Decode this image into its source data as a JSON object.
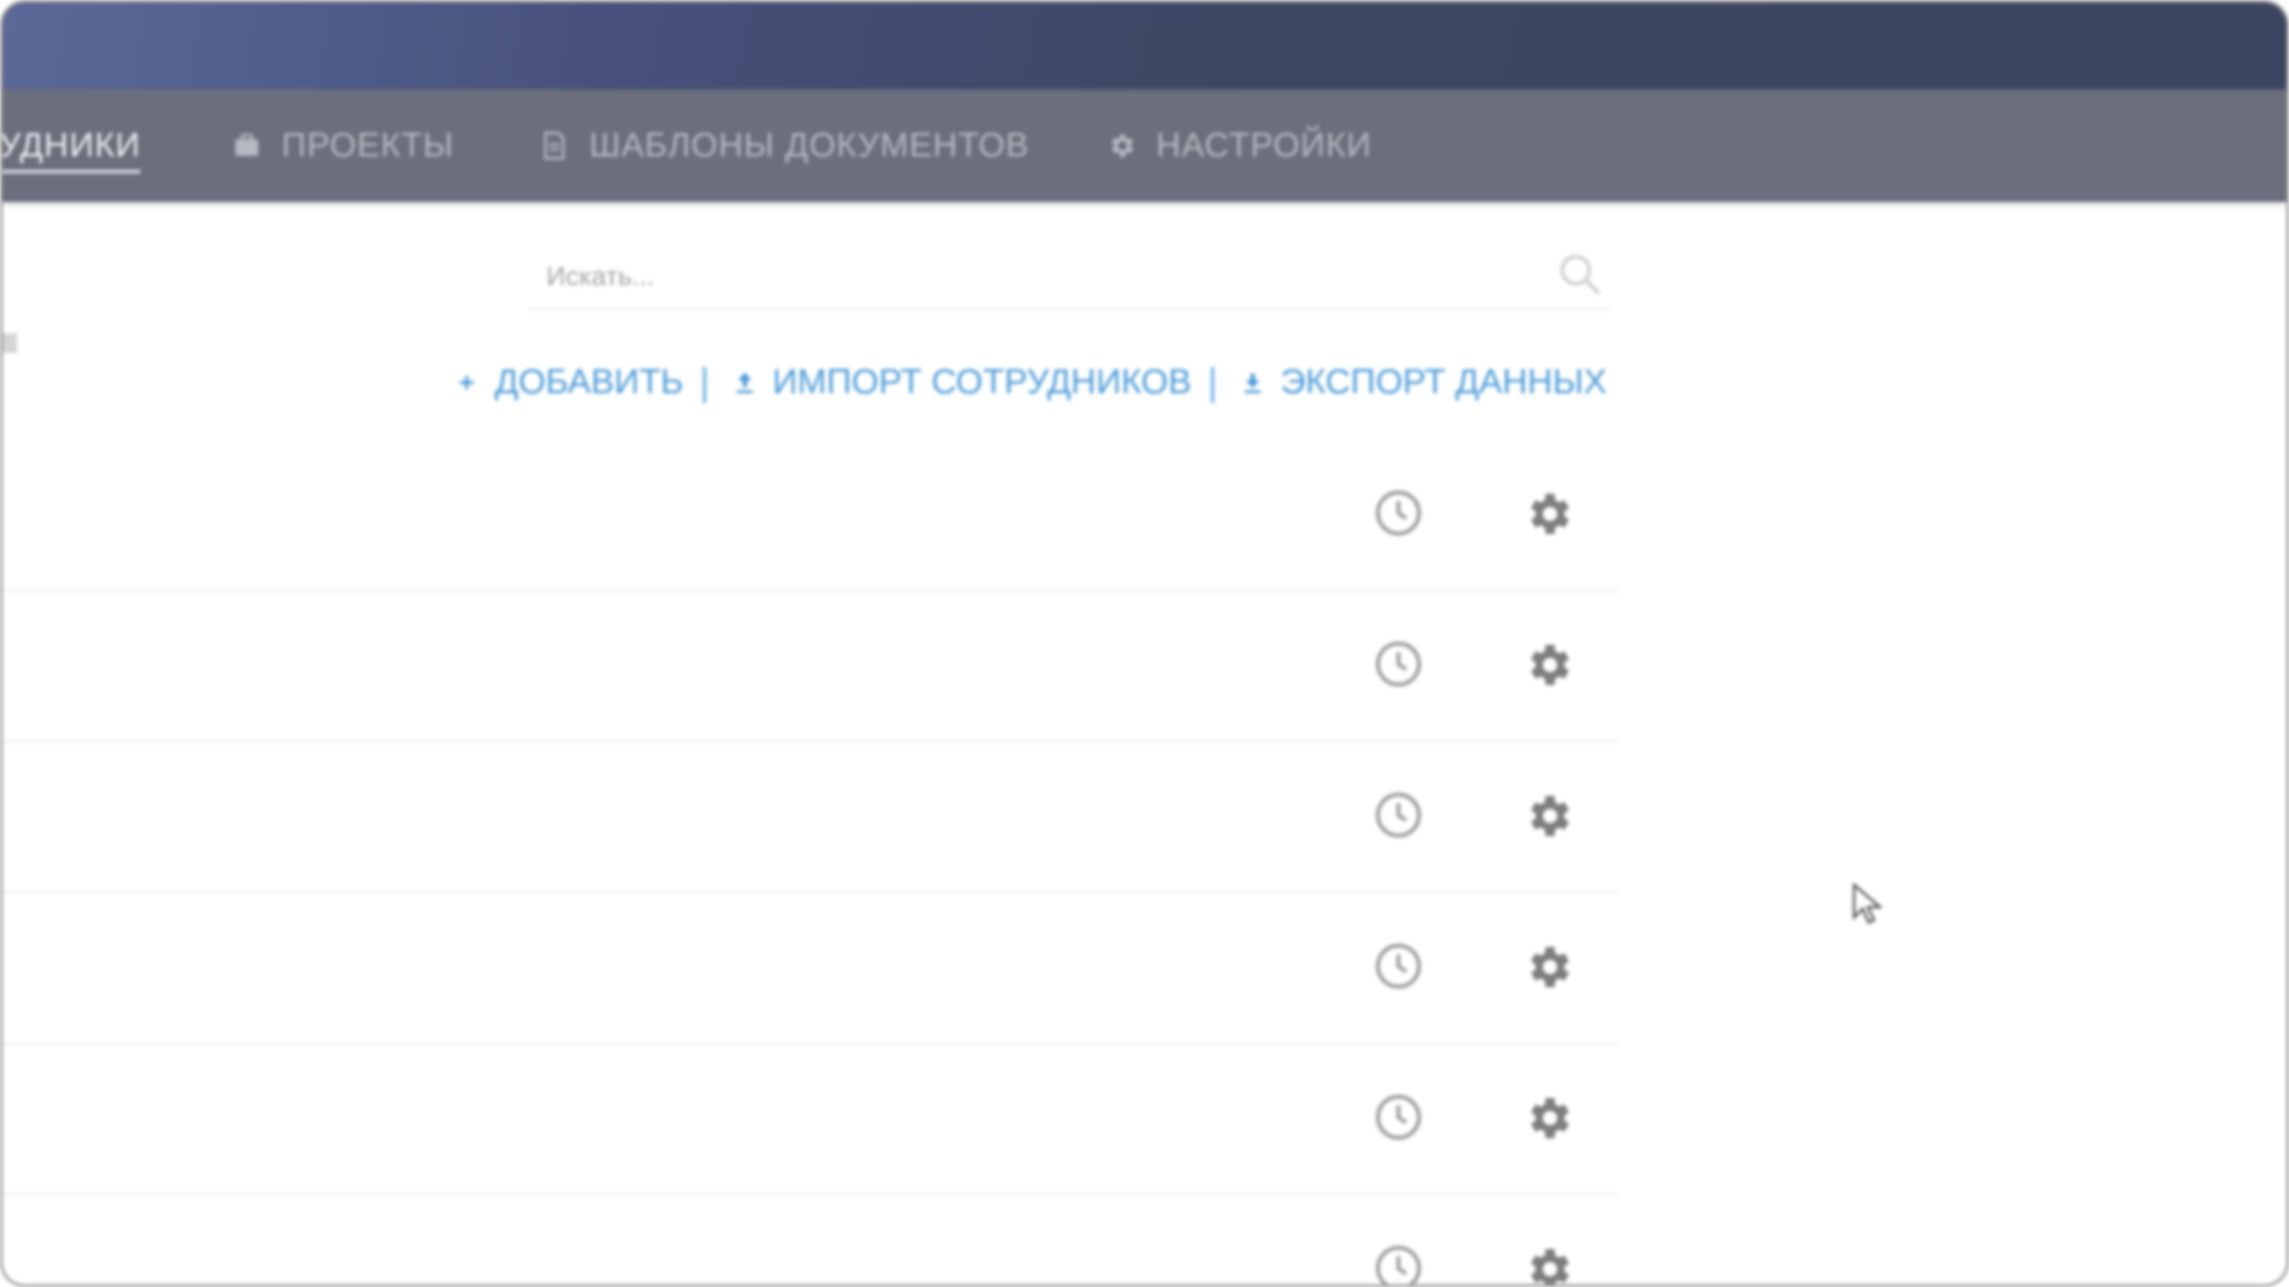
{
  "nav": {
    "tabs": [
      {
        "label": "УДНИКИ",
        "icon": "users-icon",
        "active": true
      },
      {
        "label": "ПРОЕКТЫ",
        "icon": "briefcase-icon",
        "active": false
      },
      {
        "label": "ШАБЛОНЫ ДОКУМЕНТОВ",
        "icon": "document-icon",
        "active": false
      },
      {
        "label": "НАСТРОЙКИ",
        "icon": "gear-icon",
        "active": false
      }
    ]
  },
  "search": {
    "placeholder": "Искать..."
  },
  "actions": {
    "add_label": "ДОБАВИТЬ",
    "import_label": "ИМПОРТ СОТРУДНИКОВ",
    "export_label": "ЭКСПОРТ ДАННЫХ",
    "separator": "|"
  },
  "rows": [
    {
      "icons": [
        "history-icon",
        "gear-icon"
      ]
    },
    {
      "icons": [
        "history-icon",
        "gear-icon"
      ]
    },
    {
      "icons": [
        "history-icon",
        "gear-icon"
      ]
    },
    {
      "icons": [
        "history-icon",
        "gear-icon"
      ]
    },
    {
      "icons": [
        "history-icon",
        "gear-icon"
      ]
    },
    {
      "icons": [
        "history-icon",
        "gear-icon"
      ]
    }
  ],
  "colors": {
    "header_dark": "#3c455f",
    "nav_bar": "#6b6e7c",
    "link_blue": "#4b9ad8",
    "icon_gray": "#8f8f8f"
  }
}
